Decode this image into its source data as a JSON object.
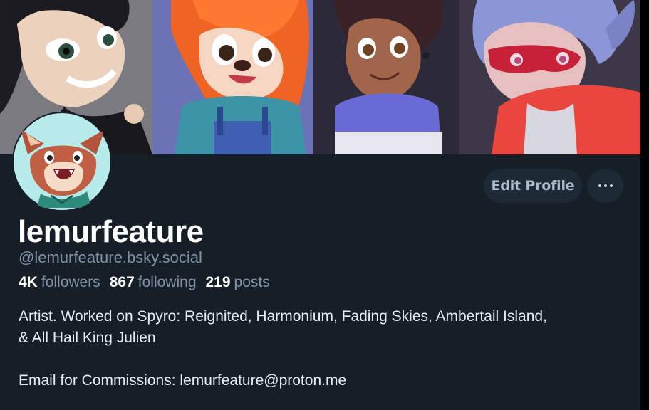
{
  "profile": {
    "display_name": "lemurfeature",
    "handle": "@lemurfeature.bsky.social",
    "stats": {
      "followers_count": "4K",
      "followers_label": "followers",
      "following_count": "867",
      "following_label": "following",
      "posts_count": "219",
      "posts_label": "posts"
    },
    "bio": {
      "line1": "Artist. Worked on Spyro: Reignited, Harmonium, Fading Skies, Ambertail Island,",
      "line2": "& All Hail King Julien",
      "line3": "Email for Commissions: lemurfeature@proton.me"
    }
  },
  "actions": {
    "edit_profile_label": "Edit Profile",
    "more_icon": "ellipsis-icon"
  },
  "colors": {
    "background": "#161e27",
    "button_background": "#1e2936",
    "muted_text": "#8193a7",
    "primary_text": "#ffffff"
  }
}
